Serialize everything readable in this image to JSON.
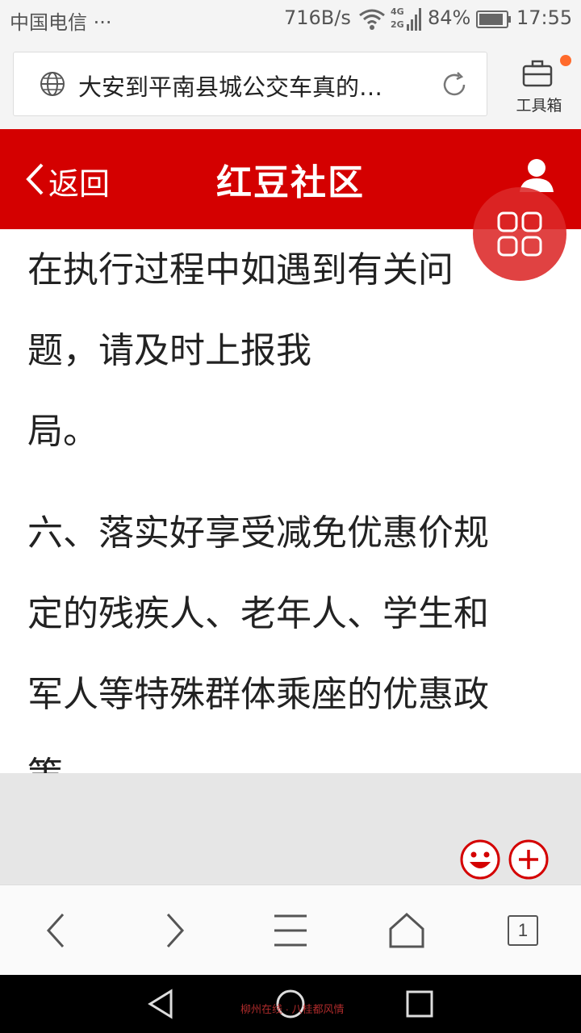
{
  "status_bar": {
    "carrier": "中国电信 ···",
    "network_speed": "716B/s",
    "battery": "84%",
    "time": "17:55",
    "icons": [
      "wifi-icon",
      "cellular-4g-2g-icon",
      "battery-icon"
    ]
  },
  "browser": {
    "url_title": "大安到平南县城公交车真的…",
    "toolbox_label": "工具箱",
    "tab_count": "1",
    "icons": [
      "globe-icon",
      "reload-icon",
      "toolbox-icon",
      "notification-dot"
    ]
  },
  "site_header": {
    "back_label": "返回",
    "logo": "红豆社区",
    "icons": [
      "chevron-left-icon",
      "user-icon",
      "grid-menu-icon"
    ]
  },
  "article": {
    "lines": [
      "在执行过程中如遇到有关问",
      "题，请及时上报我",
      "局。",
      "六、落实好享受减免优惠价规",
      "定的残疾人、老年人、学生和",
      "军人等特殊群体乘座的优惠政",
      "策。"
    ]
  },
  "bottom_nav": {
    "items": [
      "back-icon",
      "forward-icon",
      "menu-icon",
      "home-icon",
      "tabs-icon"
    ]
  },
  "system_nav": {
    "items": [
      "system-back-icon",
      "system-home-icon",
      "system-recents-icon"
    ]
  },
  "watermark": "柳州在线 · 八桂都风情",
  "colors": {
    "brand_red": "#d40000",
    "accent_orange": "#ff6a2b"
  }
}
